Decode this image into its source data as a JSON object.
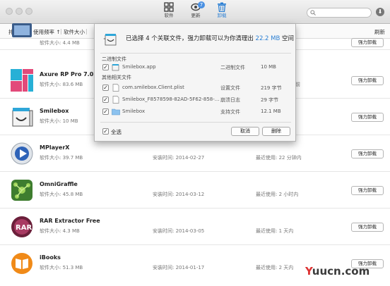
{
  "toolbar": {
    "software_label": "软件",
    "update_label": "更新",
    "update_badge": "7",
    "uninstall_label": "卸载"
  },
  "sortbar": {
    "sort_label": "排序方法:",
    "sort_value": "使用频率 ↑",
    "software_size": "软件大小",
    "refresh": "刷新"
  },
  "apps": [
    {
      "name": "",
      "size": "软件大小: 4.4 MB",
      "install": "",
      "lastused": "",
      "button": "强力卸载"
    },
    {
      "name": "Axure RP Pro 7.0 Beta",
      "size": "软件大小: 83.6 MB",
      "install": "",
      "lastused": "前",
      "button": "强力卸载"
    },
    {
      "name": "Smilebox",
      "size": "软件大小: 10 MB",
      "install": "",
      "lastused": "",
      "button": "强力卸载"
    },
    {
      "name": "MPlayerX",
      "size": "软件大小: 39.7 MB",
      "install": "安装时间: 2014-02-27",
      "lastused": "最近使用: 22 分钟内",
      "button": "强力卸载"
    },
    {
      "name": "OmniGraffle",
      "size": "软件大小: 45.8 MB",
      "install": "安装时间: 2014-03-12",
      "lastused": "最近使用: 2 小时内",
      "button": "强力卸载"
    },
    {
      "name": "RAR Extractor Free",
      "size": "软件大小: 4.3 MB",
      "install": "安装时间: 2014-03-05",
      "lastused": "最近使用: 1 天内",
      "button": "强力卸载"
    },
    {
      "name": "iBooks",
      "size": "软件大小: 51.3 MB",
      "install": "安装时间: 2014-01-17",
      "lastused": "最近使用: 2 天内",
      "button": "强力卸载"
    }
  ],
  "dialog": {
    "headline_pre": "已选择 4 个关联文件，强力卸载可以为你清理出 ",
    "headline_size": "22.2 MB",
    "headline_post": " 空间",
    "binary_section": "二进制文件",
    "other_section": "其他相关文件",
    "files": [
      {
        "name": "Smilebox.app",
        "type": "二进制文件",
        "size": "10 MB"
      },
      {
        "name": "com.smilebox.Client.plist",
        "type": "设置文件",
        "size": "219 字节"
      },
      {
        "name": "Smilebox_F8578598-82AD-5F62-858-...",
        "type": "崩溃日志",
        "size": "29 字节"
      },
      {
        "name": "Smilebox",
        "type": "支持文件",
        "size": "12.1 MB"
      }
    ],
    "select_all": "全选",
    "cancel": "取消",
    "delete": "删除"
  },
  "watermark": {
    "y": "Y",
    "rest": "uucn.com"
  }
}
